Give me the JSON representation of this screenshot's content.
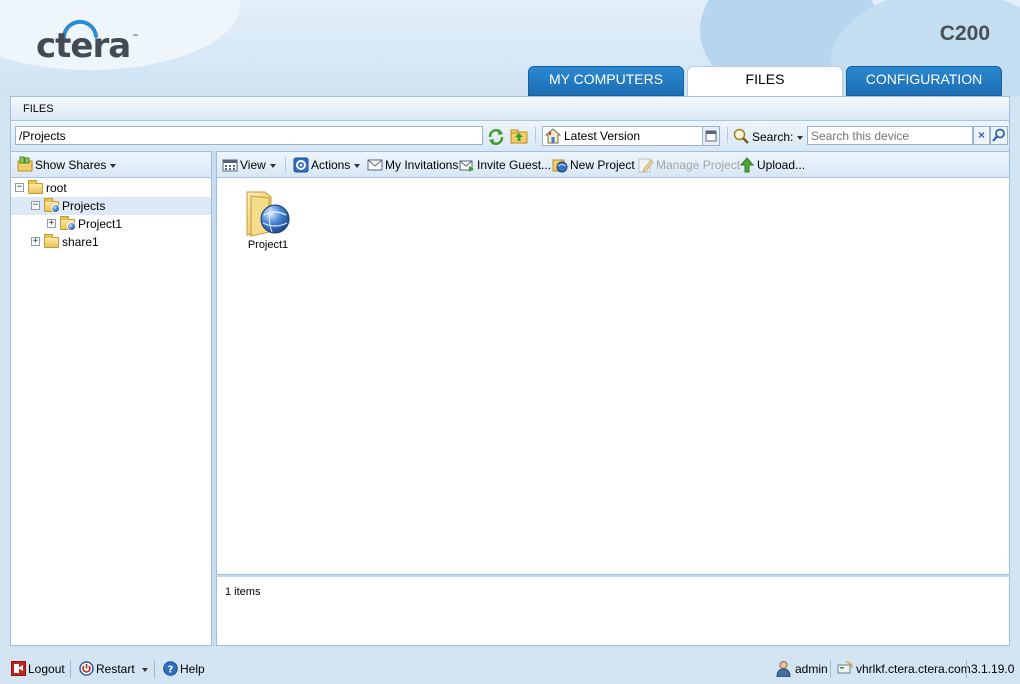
{
  "header": {
    "logo_text": "ctera",
    "logo_tm": "™",
    "device_name": "C200",
    "tabs": [
      {
        "label": "MY COMPUTERS",
        "active": false
      },
      {
        "label": "FILES",
        "active": true
      },
      {
        "label": "CONFIGURATION",
        "active": false
      }
    ]
  },
  "section_title": "FILES",
  "address_bar": {
    "path": "/Projects",
    "version": "Latest Version",
    "search_label": "Search:",
    "search_placeholder": "Search this device",
    "clear_symbol": "×"
  },
  "left_panel": {
    "show_shares_label": "Show Shares",
    "tree": [
      {
        "label": "root",
        "expander": "−",
        "level": 0
      },
      {
        "label": "Projects",
        "expander": "−",
        "level": 1,
        "selected": true
      },
      {
        "label": "Project1",
        "expander": "+",
        "level": 2
      },
      {
        "label": "share1",
        "expander": "+",
        "level": 1
      }
    ]
  },
  "toolbar": {
    "view_label": "View",
    "actions_label": "Actions",
    "invitations_label": "My Invitations",
    "invite_guest_label": "Invite Guest...",
    "new_project_label": "New Project",
    "manage_project_label": "Manage Project",
    "upload_label": "Upload..."
  },
  "files": [
    {
      "name": "Project1",
      "icon": "shared-folder-globe-icon"
    }
  ],
  "status": {
    "item_count": "1 items"
  },
  "footer": {
    "logout_label": "Logout",
    "restart_label": "Restart",
    "help_label": "Help",
    "user": "admin",
    "host": "vhrlkf.ctera.ctera.com",
    "version": "3.1.19.0"
  },
  "colors": {
    "tab_blue": "#1d6db4",
    "page_bg": "#d3e5f3",
    "panel_border": "#9ebfdc",
    "selection": "#dde9f6"
  }
}
